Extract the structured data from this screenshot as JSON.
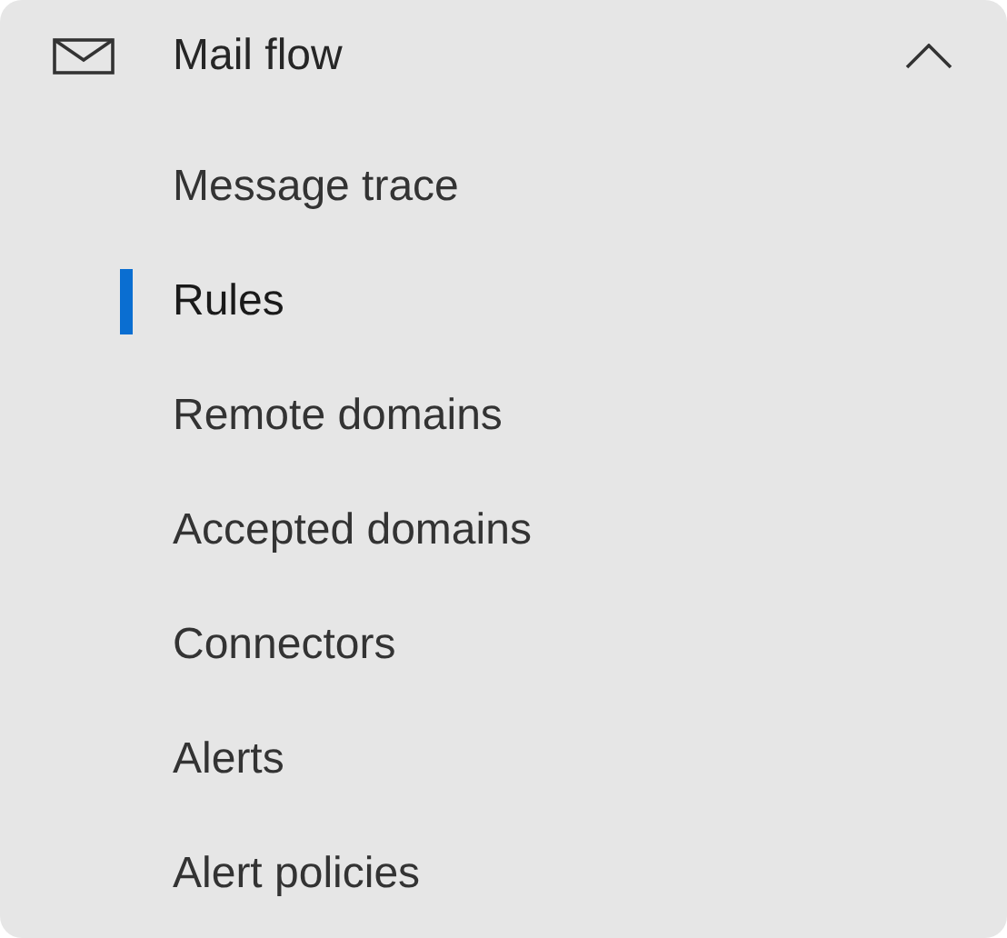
{
  "section": {
    "title": "Mail flow",
    "expanded": true
  },
  "items": [
    {
      "label": "Message trace",
      "selected": false
    },
    {
      "label": "Rules",
      "selected": true
    },
    {
      "label": "Remote domains",
      "selected": false
    },
    {
      "label": "Accepted domains",
      "selected": false
    },
    {
      "label": "Connectors",
      "selected": false
    },
    {
      "label": "Alerts",
      "selected": false
    },
    {
      "label": "Alert policies",
      "selected": false
    }
  ]
}
